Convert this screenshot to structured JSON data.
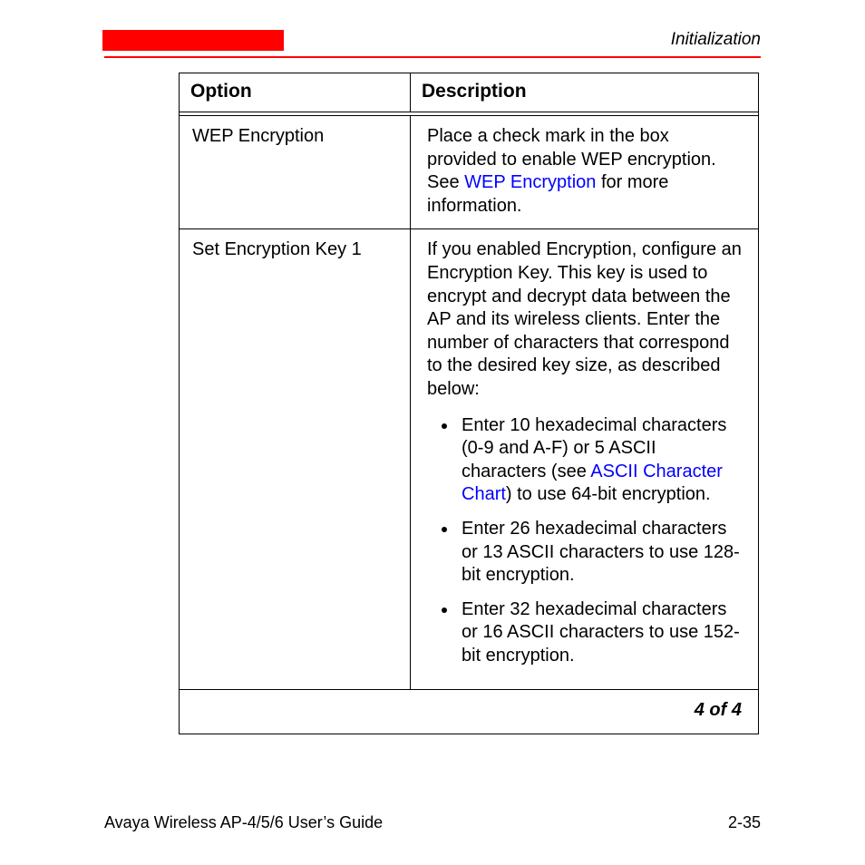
{
  "header": {
    "section_title": "Initialization"
  },
  "table": {
    "cols": {
      "option": "Option",
      "description": "Description"
    },
    "rows": [
      {
        "option": "WEP Encryption",
        "desc_before_link": "Place a check mark in the box provided to enable WEP encryption. See ",
        "desc_link": "WEP Encryption",
        "desc_after_link": " for more information."
      },
      {
        "option": "Set Encryption Key 1",
        "intro": "If you enabled Encryption, configure an Encryption Key. This key is used to encrypt and decrypt data between the AP and its wireless clients. Enter the number of characters that correspond to the desired key size, as described below:",
        "bullets": [
          {
            "pre": "Enter 10 hexadecimal characters (0-9 and A-F) or 5 ASCII characters (see ",
            "link": "ASCII Character Chart",
            "post": ") to use 64-bit encryption."
          },
          {
            "pre": "Enter 26 hexadecimal characters or 13 ASCII characters to use 128-bit encryption.",
            "link": "",
            "post": ""
          },
          {
            "pre": "Enter 32 hexadecimal characters or 16 ASCII characters to use 152-bit encryption.",
            "link": "",
            "post": ""
          }
        ]
      }
    ],
    "page_count": "4 of 4"
  },
  "footer": {
    "doc_title": "Avaya Wireless AP-4/5/6 User’s Guide",
    "page_no": "2-35"
  }
}
